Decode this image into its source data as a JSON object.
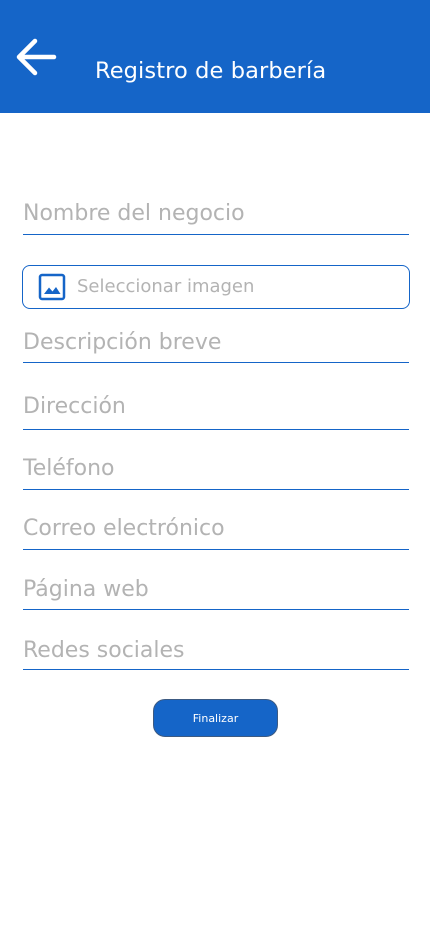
{
  "header": {
    "title": "Registro de barbería",
    "back_icon": "arrow-left-icon",
    "background": "#1565c8"
  },
  "form": {
    "business_name": {
      "placeholder": "Nombre del negocio",
      "value": ""
    },
    "image_picker": {
      "label": "Seleccionar imagen",
      "icon": "image-icon"
    },
    "description": {
      "placeholder": "Descripción breve",
      "value": ""
    },
    "address": {
      "placeholder": "Dirección",
      "value": ""
    },
    "phone": {
      "placeholder": "Teléfono",
      "value": ""
    },
    "email": {
      "placeholder": "Correo electrónico",
      "value": ""
    },
    "website": {
      "placeholder": "Página web",
      "value": ""
    },
    "social": {
      "placeholder": "Redes sociales",
      "value": ""
    },
    "submit_label": "Finalizar"
  },
  "colors": {
    "accent": "#1565c8",
    "placeholder": "#b3b3b3",
    "background": "#ffffff"
  }
}
